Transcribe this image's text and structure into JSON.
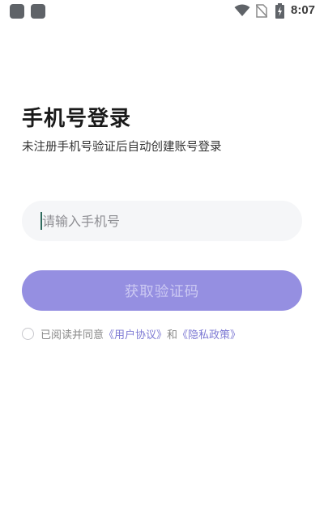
{
  "status_bar": {
    "time": "8:07",
    "icons": [
      "notification-icon",
      "notification-icon",
      "wifi-icon",
      "no-sim-icon",
      "battery-charging-icon"
    ]
  },
  "header": {
    "title": "手机号登录",
    "subtitle": "未注册手机号验证后自动创建账号登录"
  },
  "phone_input": {
    "value": "",
    "placeholder": "请输入手机号"
  },
  "get_code_button": {
    "label": "获取验证码"
  },
  "agreement": {
    "checked": false,
    "prefix": "已阅读并同意",
    "user_agreement": "《用户协议》",
    "conjunction": "和",
    "privacy_policy": "《隐私政策》"
  },
  "colors": {
    "accent": "#958fe1",
    "link": "#7e7ad4",
    "input_bg": "#f5f6f8"
  }
}
